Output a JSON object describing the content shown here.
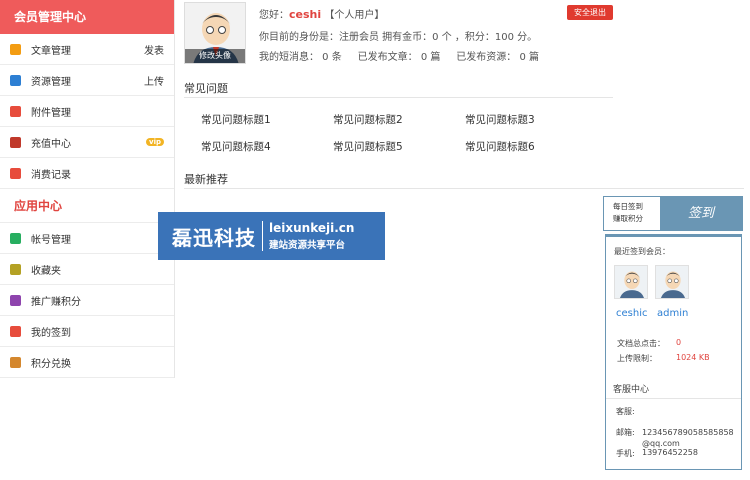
{
  "sidebar": {
    "header": "会员管理中心",
    "items": [
      {
        "label": "文章管理",
        "right": "发表"
      },
      {
        "label": "资源管理",
        "right": "上传"
      },
      {
        "label": "附件管理",
        "right": ""
      },
      {
        "label": "充值中心",
        "right": "vip"
      },
      {
        "label": "消费记录",
        "right": ""
      }
    ],
    "apps_header": "应用中心",
    "apps": [
      {
        "label": "帐号管理"
      },
      {
        "label": "收藏夹"
      },
      {
        "label": "推广赚积分"
      },
      {
        "label": "我的签到"
      },
      {
        "label": "积分兑换"
      }
    ]
  },
  "user": {
    "greeting": "您好：",
    "name": "ceshi",
    "role_tag": "【个人用户】",
    "avatar_edit": "修改头像",
    "identity_line": "你目前的身份是：注册会员 拥有金币：0 个 ，积分：100 分。",
    "messages": "我的短消息：  0 条",
    "articles": "已发布文章：  0 篇",
    "resources": "已发布资源：  0 篇",
    "logout": "安全退出"
  },
  "faq": {
    "title": "常见问题",
    "items": [
      "常见问题标题1",
      "常见问题标题2",
      "常见问题标题3",
      "常见问题标题4",
      "常见问题标题5",
      "常见问题标题6"
    ]
  },
  "recommend": {
    "title": "最新推荐"
  },
  "banner": {
    "main": "磊迅科技",
    "domain": "leixunkeji.cn",
    "slogan": "建站资源共享平台"
  },
  "signin": {
    "line1": "每日签到",
    "line2": "赚取积分",
    "button": "签到"
  },
  "panel": {
    "recent_title": "最近签到会员：",
    "members": [
      "ceshic",
      "admin"
    ],
    "clicks_label": "文档总点击：",
    "clicks_value": "0",
    "upload_label": "上传限制：",
    "upload_value": "1024 KB",
    "service_title": "客服中心",
    "service_label": "客服:",
    "email_label": "邮箱:",
    "email_value": "123456789058585858@qq.com",
    "phone_label": "手机:",
    "phone_value": "13976452258"
  }
}
